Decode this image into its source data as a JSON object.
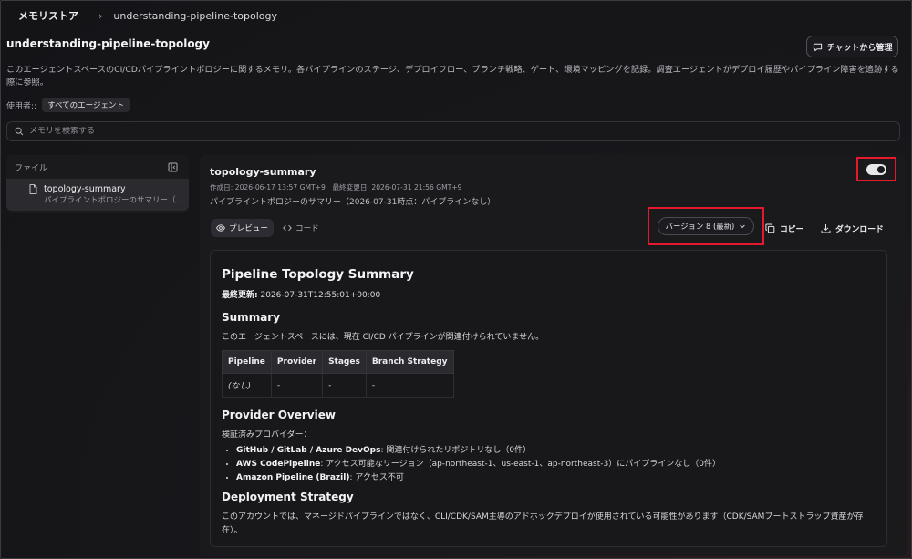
{
  "breadcrumb": {
    "root": "メモリストア",
    "current": "understanding-pipeline-topology"
  },
  "page": {
    "title": "understanding-pipeline-topology",
    "description": "このエージェントスペースのCI/CDパイプライントポロジーに関するメモリ。各パイプラインのステージ、デプロイフロー、ブランチ戦略、ゲート、環境マッピングを記録。調査エージェントがデプロイ履歴やパイプライン障害を追跡する際に参照。",
    "used_by_label": "使用者::",
    "used_by_tag": "すべてのエージェント",
    "chat_button": "チャットから管理"
  },
  "search": {
    "placeholder": "メモリを検索する"
  },
  "sidebar": {
    "header": "ファイル",
    "files": [
      {
        "name": "topology-summary",
        "desc": "パイプライントポロジーのサマリー（..."
      }
    ]
  },
  "document": {
    "name": "topology-summary",
    "dates": "作成日: 2026-06-17 13:57 GMT+9　最終変更日: 2026-07-31 21:56 GMT+9",
    "summary": "パイプライントポロジーのサマリー（2026-07-31時点：パイプラインなし）",
    "toggle_on": true,
    "tabs": {
      "preview": "プレビュー",
      "code": "コード"
    },
    "version_label": "バージョン 8 (最新)",
    "copy_label": "コピー",
    "download_label": "ダウンロード"
  },
  "content": {
    "h1": "Pipeline Topology Summary",
    "updated_label": "最終更新:",
    "updated_value": " 2026-07-31T12:55:01+00:00",
    "summary_heading": "Summary",
    "summary_text": "このエージェントスペースには、現在 CI/CD パイプラインが関連付けられていません。",
    "table_headers": [
      "Pipeline",
      "Provider",
      "Stages",
      "Branch Strategy"
    ],
    "table_row": [
      "(なし)",
      "-",
      "-",
      "-"
    ],
    "provider_heading": "Provider Overview",
    "provider_intro": "検証済みプロバイダー：",
    "providers": [
      {
        "name": "GitHub / GitLab / Azure DevOps",
        "detail": ": 関連付けられたリポジトリなし（0件）"
      },
      {
        "name": "AWS CodePipeline",
        "detail": ": アクセス可能なリージョン（ap-northeast-1、us-east-1、ap-northeast-3）にパイプラインなし（0件）"
      },
      {
        "name": "Amazon Pipeline (Brazil)",
        "detail": ": アクセス不可"
      }
    ],
    "deploy_heading": "Deployment Strategy",
    "deploy_text": "このアカウントでは、マネージドパイプラインではなく、CLI/CDK/SAM主導のアドホックデプロイが使用されている可能性があります（CDK/SAMブートストラップ資産が存在）。"
  }
}
